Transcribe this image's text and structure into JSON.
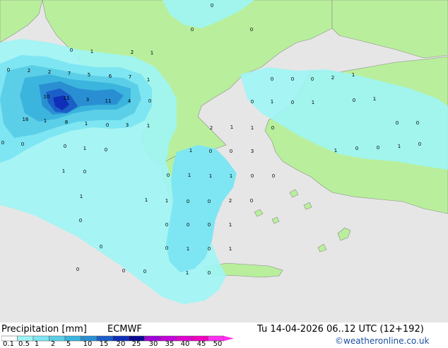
{
  "map": {
    "colors": {
      "sea": "#e6e6e6",
      "land": "#b9ef9c",
      "border": "#8a8a8a"
    },
    "values": [
      "0",
      "1",
      "0",
      "2",
      "1",
      "0",
      "0",
      "0",
      "2",
      "2",
      "7",
      "5",
      "6",
      "7",
      "1",
      "10",
      "11",
      "3",
      "11",
      "4",
      "0",
      "16",
      "1",
      "8",
      "1",
      "0",
      "3",
      "1",
      "0",
      "0",
      "0",
      "1",
      "0",
      "0",
      "0",
      "0",
      "2",
      "1",
      "0",
      "1",
      "0",
      "1",
      "0",
      "1",
      "2",
      "1",
      "1",
      "0",
      "1",
      "0",
      "0",
      "3",
      "1",
      "0",
      "0",
      "1",
      "0",
      "0",
      "0",
      "1",
      "0",
      "0",
      "1",
      "1",
      "1",
      "0",
      "0",
      "1",
      "1",
      "1",
      "0",
      "0",
      "2",
      "0",
      "0",
      "0",
      "0",
      "0",
      "1",
      "0",
      "0",
      "1",
      "0",
      "1",
      "0",
      "0",
      "0",
      "1",
      "0"
    ]
  },
  "footer": {
    "title": "Precipitation [mm]",
    "model": "ECMWF",
    "datetime": "Tu 14-04-2026 06..12 UTC (12+192)",
    "copyright": "©weatheronline.co.uk",
    "scale": {
      "labels": [
        "0.1",
        "0.5",
        "1",
        "2",
        "5",
        "10",
        "15",
        "20",
        "25",
        "30",
        "35",
        "40",
        "45",
        "50"
      ],
      "colors": [
        "#ffffff",
        "#9ff5f5",
        "#7ee6f2",
        "#5ccfe8",
        "#3bb5de",
        "#2a8fd2",
        "#1c5ec8",
        "#0f2fb8",
        "#0a0a90",
        "#a000d8",
        "#c400d8",
        "#e000d0",
        "#f000c0",
        "#ff30f0"
      ]
    }
  }
}
